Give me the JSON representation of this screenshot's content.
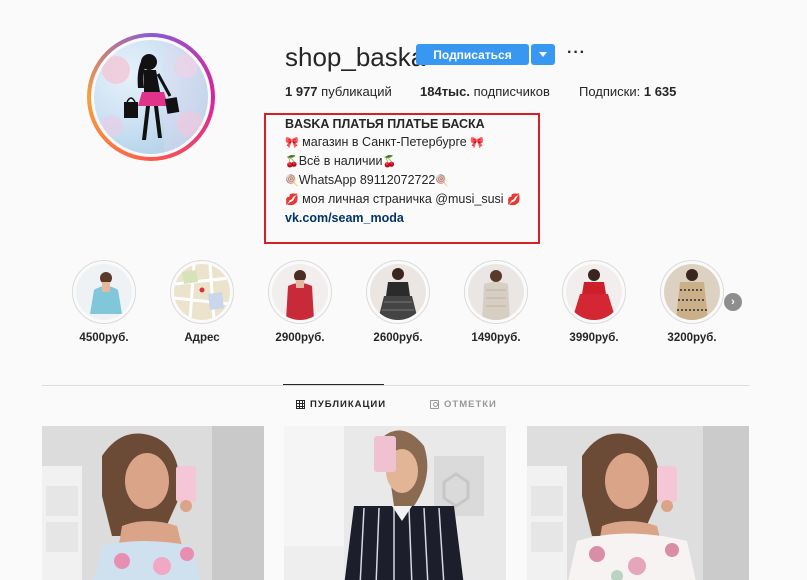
{
  "profile": {
    "username": "shop_baska",
    "follow_label": "Подписаться",
    "more_label": "···"
  },
  "stats": {
    "posts_count": "1 977",
    "posts_label": " публикаций",
    "followers_count": "184тыс.",
    "followers_label": " подписчиков",
    "following_label": "Подписки: ",
    "following_count": "1 635"
  },
  "bio": {
    "name": "BASKA ПЛАТЬЯ ПЛАТЬЕ БАСКА",
    "line1": " магазин в Санкт-Петербурге ",
    "line2": "Всё в наличии",
    "line3": "WhatsApp 89112072722",
    "line4": " моя личная страничка @musi_susi ",
    "link": "vk.com/seam_moda"
  },
  "highlights": [
    {
      "label": "4500руб.",
      "color": "#7fc7d9"
    },
    {
      "label": "Адрес",
      "color": "#e7dcc0"
    },
    {
      "label": "2900руб.",
      "color": "#c92a3a"
    },
    {
      "label": "2600руб.",
      "color": "#2b2b2b"
    },
    {
      "label": "1490руб.",
      "color": "#d8cfc4"
    },
    {
      "label": "3990руб.",
      "color": "#cc1f2a"
    },
    {
      "label": "3200руб.",
      "color": "#c9b089"
    }
  ],
  "tabs": {
    "posts": "ПУБЛИКАЦИИ",
    "tagged": "ОТМЕТКИ"
  },
  "colors": {
    "accent": "#3897f0",
    "highlight_box": "#d81f26",
    "link": "#003569"
  }
}
